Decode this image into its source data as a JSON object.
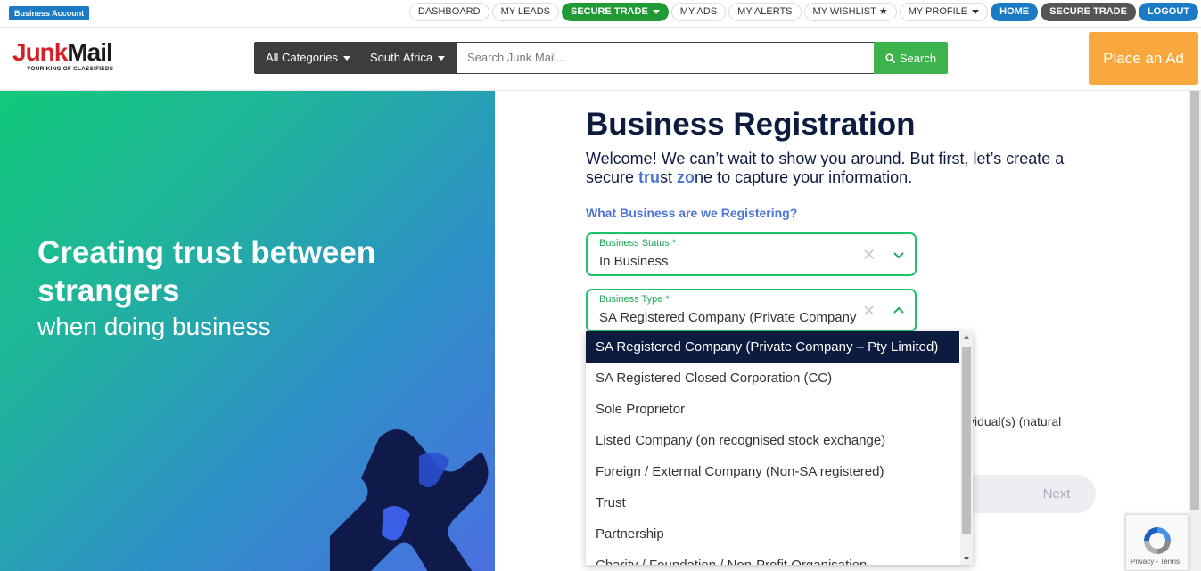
{
  "topbar": {
    "badge": "Business Account",
    "nav": [
      {
        "label": "DASHBOARD"
      },
      {
        "label": "MY LEADS"
      },
      {
        "label": "SECURE TRADE"
      },
      {
        "label": "MY ADS"
      },
      {
        "label": "MY ALERTS"
      },
      {
        "label": "MY WISHLIST"
      },
      {
        "label": "MY PROFILE"
      },
      {
        "label": "HOME"
      },
      {
        "label": "SECURE TRADE"
      },
      {
        "label": "LOGOUT"
      }
    ]
  },
  "header": {
    "logo_part1": "Junk",
    "logo_part2": "Mail",
    "logo_tagline": "YOUR KING OF CLASSIFIEDS",
    "category_dropdown": "All Categories",
    "country_dropdown": "South Africa",
    "search_placeholder": "Search Junk Mail...",
    "search_button": "Search",
    "place_ad": "Place an Ad"
  },
  "hero": {
    "title": "Creating trust between strangers",
    "subtitle": "when doing business"
  },
  "form": {
    "title": "Business Registration",
    "intro_a": "Welcome! We can’t wait to show you around. But first, let’s create a secure ",
    "intro_hl1a": "tru",
    "intro_mid1": "st ",
    "intro_hl2": "zo",
    "intro_b": "ne to capture your information.",
    "section_label": "What Business are we Registering?",
    "status_field": {
      "label": "Business Status *",
      "value": "In Business"
    },
    "type_field": {
      "label": "Business Type *",
      "value": "SA Registered Company (Private Company – Pty Limited)"
    },
    "behind_text": "vidual(s) (natural",
    "next_button": "Next"
  },
  "dropdown": {
    "options": [
      "SA Registered Company (Private Company – Pty Limited)",
      "SA Registered Closed Corporation (CC)",
      "Sole Proprietor",
      "Listed Company (on recognised stock exchange)",
      "Foreign / External Company (Non-SA registered)",
      "Trust",
      "Partnership",
      "Charity / Foundation / Non-Profit Organisation"
    ]
  },
  "recaptcha": {
    "links": "Privacy - Terms"
  },
  "colors": {
    "accent_green": "#1fc36a",
    "brand_navy": "#0d1b3e",
    "link_blue": "#4b74d8",
    "place_ad_orange": "#f9a83d"
  }
}
